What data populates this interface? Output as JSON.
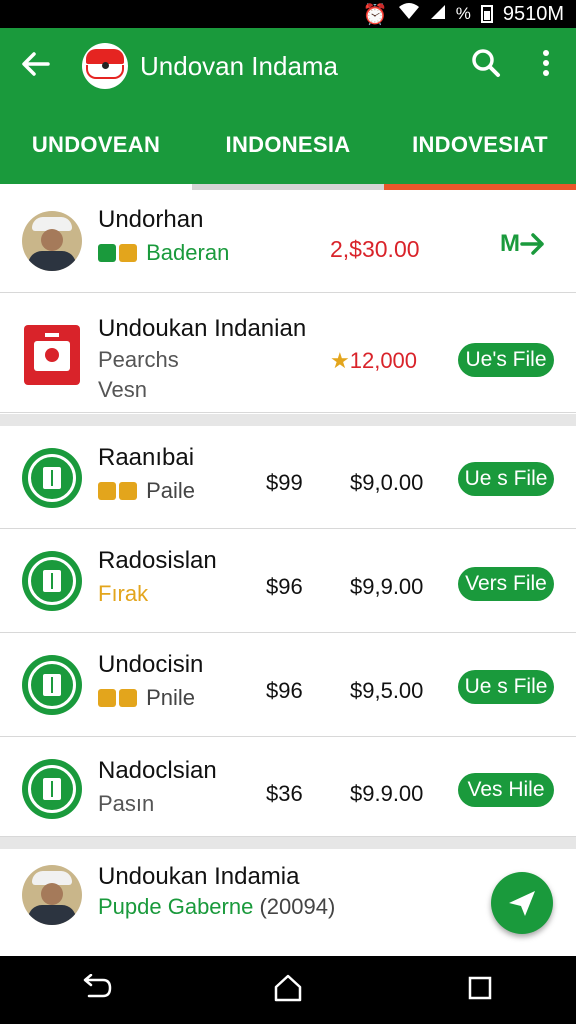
{
  "status": {
    "percent": "%",
    "time": "9510M"
  },
  "appbar": {
    "title": "Undovan Indamа"
  },
  "tabs": [
    "UNDOVEAN",
    "INDONESIA",
    "INDOVESIAT"
  ],
  "tab_indicator_colors": [
    "#ffffff",
    "#d5d5d5",
    "#e9572b"
  ],
  "items": [
    {
      "name": "Undorhan",
      "sub": "Baderan",
      "sub_color": "#1a9a3c",
      "badges": [
        "green",
        "gold"
      ],
      "price": "2,$30.00",
      "price_color": "#d9232a",
      "action": "M"
    },
    {
      "name": "Undoukan Indanian",
      "sub": "Pearchs",
      "sub2": "Vesn",
      "price": "12,000",
      "price_color": "#d9232a",
      "action": "Ue's File"
    },
    {
      "name": "Raanıbai",
      "sub": "Paile",
      "badges": [
        "gold",
        "gold"
      ],
      "price1": "$99",
      "price2": "$9,0.00",
      "action": "Ue s File"
    },
    {
      "name": "Radosislan",
      "sub": "Fırak",
      "sub_color": "#e3a51c",
      "price1": "$96",
      "price2": "$9,9.00",
      "action": "Vers File"
    },
    {
      "name": "Undocisin",
      "sub": "Pnile",
      "badges": [
        "gold",
        "gold"
      ],
      "price1": "$96",
      "price2": "$9,5.00",
      "action": "Ue s File"
    },
    {
      "name": "Nadoclsian",
      "sub": "Pasın",
      "price1": "$36",
      "price2": "$9.9.00",
      "action": "Ves Hile"
    },
    {
      "name": "Undoukan Indamia",
      "sub": "Pupde Gaberne",
      "sub_suffix": " (20094)"
    }
  ]
}
